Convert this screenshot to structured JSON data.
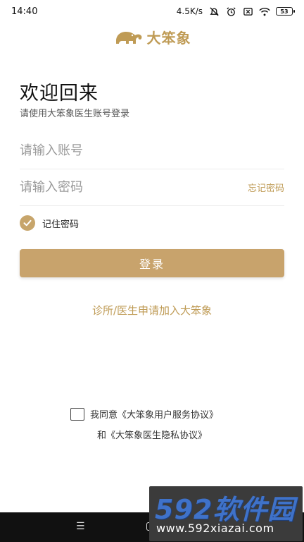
{
  "status_bar": {
    "time": "14:40",
    "network_speed": "4.5K/s",
    "battery": "53",
    "icons": [
      "mute-icon",
      "alarm-icon",
      "sim-off-icon",
      "wifi-icon",
      "battery-icon"
    ]
  },
  "logo": {
    "text": "大笨象"
  },
  "heading": {
    "title": "欢迎回来",
    "subtitle": "请使用大笨象医生账号登录"
  },
  "form": {
    "account_placeholder": "请输入账号",
    "password_placeholder": "请输入密码",
    "forgot_label": "忘记密码",
    "remember_label": "记住密码",
    "remember_checked": true,
    "login_label": "登录"
  },
  "join_link": "诊所/医生申请加入大笨象",
  "agreement": {
    "line1": "我同意《大笨象用户服务协议》",
    "line2": "和《大笨象医生隐私协议》",
    "checked": false
  },
  "watermark": {
    "title": "592软件园",
    "url": "www.592xiazai.com"
  },
  "colors": {
    "accent": "#bf9b55",
    "button": "#c8a36c"
  }
}
